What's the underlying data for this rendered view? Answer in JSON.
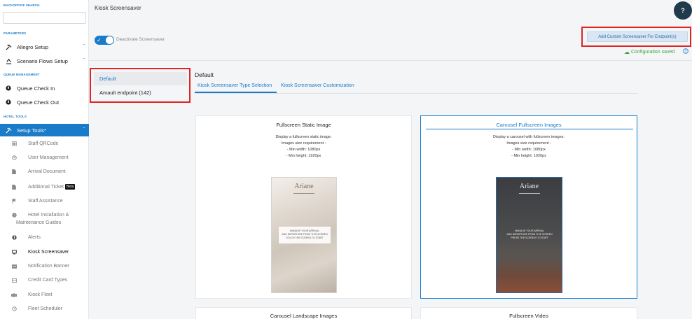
{
  "sidebar": {
    "search_label": "BACKOFFICE SEARCH",
    "parameters_label": "PARAMETERS",
    "queue_label": "QUEUE MANAGEMENT",
    "hotel_tools_label": "HOTEL TOOLS",
    "items": {
      "allegro": "Allegro Setup",
      "scenario": "Scenario Flows Setup",
      "checkin": "Queue Check In",
      "checkout": "Queue Check Out",
      "setup_tools": "Setup Tools*"
    },
    "sub_items": [
      "Staff QRCode",
      "User Management",
      "Arrival Document",
      "Additional Ticket",
      "Staff Assistance",
      "Hotel Installation &",
      "Maintenance Guides",
      "Alerts",
      "Kiosk Screensaver",
      "Notification Banner",
      "Credit Card Types",
      "Kiosk Fleet",
      "Fleet Scheduler"
    ],
    "beta_badge": "Beta",
    "chevron": "ˇ"
  },
  "header": {
    "title": "Kiosk Screensaver",
    "help": "?"
  },
  "toggle": {
    "label": "Deactivate Screensaver",
    "check": "✓"
  },
  "actions": {
    "add_button": "Add Custom Screensaver For Endpoint(s)",
    "saved_text": "Configuration saved",
    "saved_icon": "☁",
    "help_icon": "?"
  },
  "endpoints": [
    "Default",
    "Amault endpoint (142)"
  ],
  "content": {
    "section_title": "Default",
    "tabs": [
      "Kiosk Screensaver Type Selection",
      "Kiosk Screensaver Customization"
    ]
  },
  "cards": [
    {
      "title": "Fullscreen Static Image",
      "desc": [
        "Display a fullscreen static image.",
        "Images size requirement :",
        "- Min width: 1080px",
        "- Min height: 1920px"
      ],
      "preview": {
        "brand": "Ariane",
        "panel": [
          "MANAGE YOUR ARRIVAL",
          "AND DEPARTURE FROM THIS SCREEN",
          "TOUCH THE SCREEN TO START"
        ]
      }
    },
    {
      "title": "Carousel Fullscreen Images",
      "desc": [
        "Display a carousel with fullscreen images.",
        "Images size requirement :",
        "- Min width: 1080px",
        "- Min height: 1920px"
      ],
      "preview": {
        "brand": "Ariane",
        "panel": [
          "MANAGE YOUR ARRIVAL",
          "AND DEPARTURE FROM THIS SCREEN",
          "PRESS THE SCREEN TO START"
        ]
      }
    },
    {
      "title": "Carousel Landscape Images"
    },
    {
      "title": "Fullscreen Video"
    }
  ],
  "colors": {
    "accent": "#1a7bc8",
    "highlight_frame": "#e02424",
    "success": "#3aa63a"
  }
}
